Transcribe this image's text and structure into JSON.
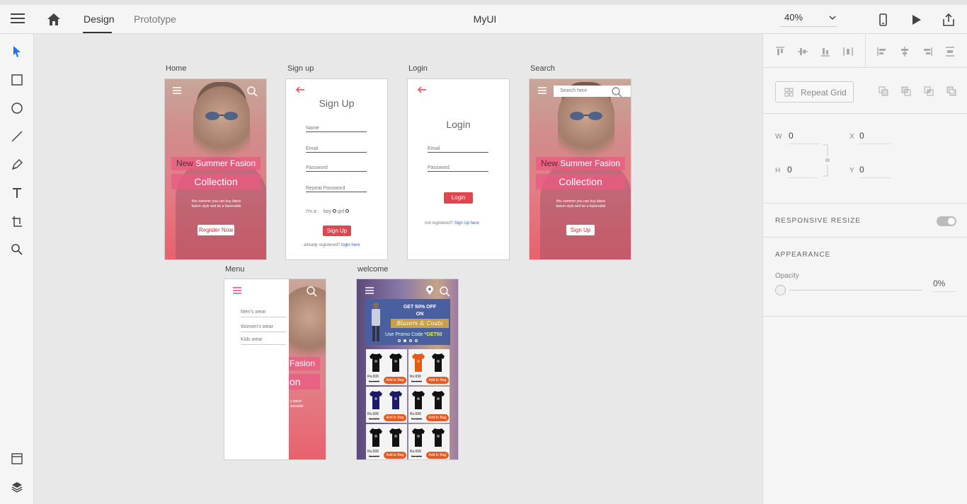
{
  "header": {
    "tabs": [
      "Design",
      "Prototype"
    ],
    "title": "MyUI",
    "zoom": "40%"
  },
  "artboards": {
    "home": {
      "label": "Home",
      "band_new": "New",
      "band_rest": " Summer Fasion",
      "collection": "Collection",
      "tagline_1": "this summer you can buy latest",
      "tagline_2": "fasion style and be a fasionable",
      "button": "Register Now"
    },
    "signup": {
      "label": "Sign up",
      "title": "Sign Up",
      "fields": [
        "Name",
        "Email",
        "Password",
        "Repeat Password"
      ],
      "gender_label": "I'm a :",
      "boy": "boy",
      "girl": "girl",
      "button": "Sign Up",
      "footer_text": "already registered?",
      "footer_link": "login here"
    },
    "login": {
      "label": "Login",
      "title": "Login",
      "fields": [
        "Email",
        "Password"
      ],
      "button": "Login",
      "footer_text": "not registered?",
      "footer_link": "Sign Up here"
    },
    "search": {
      "label": "Search",
      "placeholder": "Search here",
      "band_new": "New",
      "band_rest": " Summer Fasion",
      "collection": "Collection",
      "tagline_1": "this summer you can buy latest",
      "tagline_2": "fasion style and be a fasionable",
      "button": "Sign Up"
    },
    "menu": {
      "label": "Menu",
      "items": [
        "Men's wear",
        "Women's wear",
        "Kids wear"
      ],
      "band_fasion": "Fasion",
      "collection_partial": "on",
      "tagline_1": "y latest",
      "tagline_2": "sionable"
    },
    "welcome": {
      "label": "welcome",
      "banner_line1": "GET 50% OFF",
      "banner_line2": "ON",
      "banner_script": "Blazers & Coats",
      "promo_text": "Use Promo Code",
      "promo_code": "*GET50",
      "price": "Rs.699",
      "old_price": "Rs.1499",
      "bag_label": "Add to Bag"
    }
  },
  "panel": {
    "repeat_grid": "Repeat Grid",
    "w_label": "W",
    "w_value": "0",
    "x_label": "X",
    "x_value": "0",
    "h_label": "H",
    "h_value": "0",
    "y_label": "Y",
    "y_value": "0",
    "responsive_resize": "RESPONSIVE RESIZE",
    "appearance": "APPEARANCE",
    "opacity_label": "Opacity",
    "opacity_value": "0%"
  },
  "colors": {
    "accent_red": "#e04650",
    "link_blue": "#3a5bd0",
    "pink_band": "#eb5a82",
    "orange_button": "#e85a20"
  }
}
